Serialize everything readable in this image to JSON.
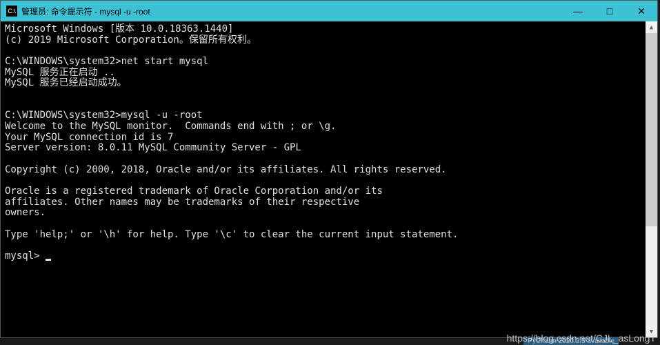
{
  "titlebar": {
    "icon_text": "C:\\",
    "title": "管理员: 命令提示符 - mysql  -u -root"
  },
  "controls": {
    "minimize": "—",
    "maximize": "□",
    "close": "✕"
  },
  "terminal": {
    "line1": "Microsoft Windows [版本 10.0.18363.1440]",
    "line2": "(c) 2019 Microsoft Corporation。保留所有权利。",
    "line3": "",
    "line4": "C:\\WINDOWS\\system32>net start mysql",
    "line5": "MySQL 服务正在启动 ..",
    "line6": "MySQL 服务已经启动成功。",
    "line7": "",
    "line8": "",
    "line9": "C:\\WINDOWS\\system32>mysql -u -root",
    "line10": "Welcome to the MySQL monitor.  Commands end with ; or \\g.",
    "line11": "Your MySQL connection id is 7",
    "line12": "Server version: 8.0.11 MySQL Community Server - GPL",
    "line13": "",
    "line14": "Copyright (c) 2000, 2018, Oracle and/or its affiliates. All rights reserved.",
    "line15": "",
    "line16": "Oracle is a registered trademark of Oracle Corporation and/or its",
    "line17": "affiliates. Other names may be trademarks of their respective",
    "line18": "owners.",
    "line19": "",
    "line20": "Type 'help;' or '\\h' for help. Type '\\c' to clear the current input statement.",
    "line21": "",
    "line22": "mysql> "
  },
  "scrollbar": {
    "up": "▲",
    "down": "▼"
  },
  "watermark": "https://blog.csdn.net/CJL_asLongT",
  "taskbar_hint": "PyCharm 2020.2.5 available"
}
